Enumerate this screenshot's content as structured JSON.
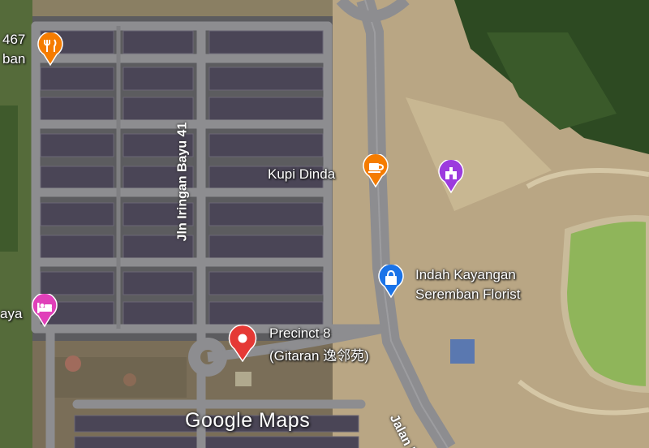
{
  "map": {
    "attribution": "Google Maps",
    "colors": {
      "poi_food": "#f57c00",
      "poi_shopping": "#1a73e8",
      "poi_lodging": "#e040b9",
      "poi_attraction": "#9c3bde",
      "selected_pin": "#e53935"
    }
  },
  "labels": {
    "partial_left_top_1": "467",
    "partial_left_top_2": "ban",
    "partial_left_mid": "aya",
    "kupi_dinda": "Kupi Dinda",
    "florist_line1": "Indah Kayangan",
    "florist_line2": "Seremban Florist",
    "precinct_line1": "Precinct 8",
    "precinct_line2": "(Gitaran 逸邻苑)"
  },
  "streets": {
    "iringan": "Jln Iringan Bayu 41",
    "jalan": "Jalan B"
  },
  "pins": {
    "restaurant": "restaurant-icon",
    "cafe": "cafe-icon",
    "attraction": "landmark-icon",
    "florist": "shopping-bag-icon",
    "hotel": "bed-icon",
    "selected": "location-pin-icon"
  }
}
